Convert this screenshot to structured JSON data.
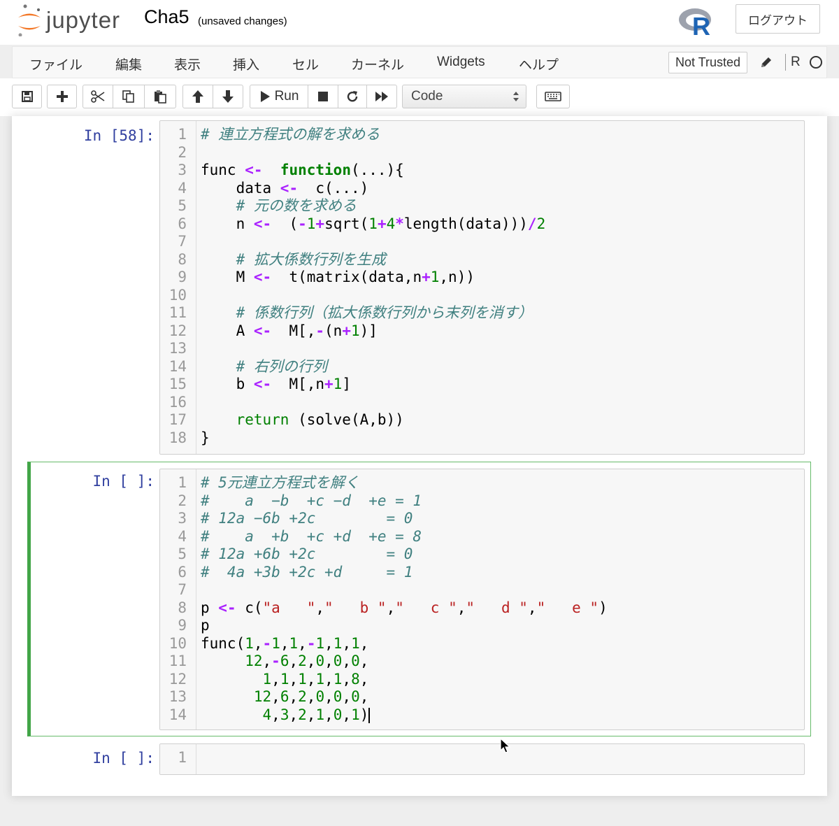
{
  "header": {
    "logo_text": "jupyter",
    "notebook_name": "Cha5",
    "save_status": "(unsaved changes)",
    "kernel_logo": "R",
    "logout_label": "ログアウト"
  },
  "menubar": {
    "items": [
      "ファイル",
      "編集",
      "表示",
      "挿入",
      "セル",
      "カーネル",
      "Widgets",
      "ヘルプ"
    ],
    "trust_label": "Not Trusted",
    "kernel_name": "R"
  },
  "toolbar": {
    "run_label": "Run",
    "cell_type": "Code",
    "icons": [
      "save-icon",
      "plus-icon",
      "cut-icon",
      "copy-icon",
      "paste-icon",
      "arrow-up-icon",
      "arrow-down-icon",
      "play-icon",
      "stop-icon",
      "restart-icon",
      "fast-forward-icon",
      "keyboard-icon"
    ]
  },
  "cells": [
    {
      "prompt": "In [58]:",
      "lines": [
        [
          [
            "c-com",
            "# 連立方程式の解を求める"
          ]
        ],
        [],
        [
          [
            "",
            "func "
          ],
          [
            "c-op",
            "<-"
          ],
          [
            "",
            "  "
          ],
          [
            "c-kw",
            "function"
          ],
          [
            "",
            "(...){"
          ]
        ],
        [
          [
            "",
            "    data "
          ],
          [
            "c-op",
            "<-"
          ],
          [
            "",
            "  c(...)"
          ]
        ],
        [
          [
            "",
            "    "
          ],
          [
            "c-com",
            "# 元の数を求める"
          ]
        ],
        [
          [
            "",
            "    n "
          ],
          [
            "c-op",
            "<-"
          ],
          [
            "",
            "  ("
          ],
          [
            "c-op",
            "-"
          ],
          [
            "c-num",
            "1"
          ],
          [
            "c-op",
            "+"
          ],
          [
            "",
            "sqrt("
          ],
          [
            "c-num",
            "1"
          ],
          [
            "c-op",
            "+"
          ],
          [
            "c-num",
            "4"
          ],
          [
            "c-op",
            "*"
          ],
          [
            "",
            "length(data)))"
          ],
          [
            "c-op",
            "/"
          ],
          [
            "c-num",
            "2"
          ]
        ],
        [],
        [
          [
            "",
            "    "
          ],
          [
            "c-com",
            "# 拡大係数行列を生成"
          ]
        ],
        [
          [
            "",
            "    M "
          ],
          [
            "c-op",
            "<-"
          ],
          [
            "",
            "  t(matrix(data,n"
          ],
          [
            "c-op",
            "+"
          ],
          [
            "c-num",
            "1"
          ],
          [
            "",
            ",n))"
          ]
        ],
        [],
        [
          [
            "",
            "    "
          ],
          [
            "c-com",
            "# 係数行列（拡大係数行列から末列を消す）"
          ]
        ],
        [
          [
            "",
            "    A "
          ],
          [
            "c-op",
            "<-"
          ],
          [
            "",
            "  M[,"
          ],
          [
            "c-op",
            "-"
          ],
          [
            "",
            "(n"
          ],
          [
            "c-op",
            "+"
          ],
          [
            "c-num",
            "1"
          ],
          [
            "",
            ")]"
          ]
        ],
        [],
        [
          [
            "",
            "    "
          ],
          [
            "c-com",
            "# 右列の行列"
          ]
        ],
        [
          [
            "",
            "    b "
          ],
          [
            "c-op",
            "<-"
          ],
          [
            "",
            "  M[,n"
          ],
          [
            "c-op",
            "+"
          ],
          [
            "c-num",
            "1"
          ],
          [
            "",
            "]"
          ]
        ],
        [],
        [
          [
            "",
            "    "
          ],
          [
            "c-ret",
            "return"
          ],
          [
            "",
            " (solve(A,b))"
          ]
        ],
        [
          [
            "",
            "}"
          ]
        ]
      ]
    },
    {
      "prompt": "In [ ]:",
      "lines": [
        [
          [
            "c-com",
            "# 5元連立方程式を解く"
          ]
        ],
        [
          [
            "c-com",
            "#    a  −b  +c −d  +e = 1"
          ]
        ],
        [
          [
            "c-com",
            "# 12a −6b +2c        = 0"
          ]
        ],
        [
          [
            "c-com",
            "#    a  +b  +c +d  +e = 8"
          ]
        ],
        [
          [
            "c-com",
            "# 12a +6b +2c        = 0"
          ]
        ],
        [
          [
            "c-com",
            "#  4a +3b +2c +d     = 1"
          ]
        ],
        [],
        [
          [
            "",
            "p "
          ],
          [
            "c-op",
            "<-"
          ],
          [
            "",
            " c("
          ],
          [
            "c-str",
            "\"a   \""
          ],
          [
            "",
            ","
          ],
          [
            "c-str",
            "\"   b \""
          ],
          [
            "",
            ","
          ],
          [
            "c-str",
            "\"   c \""
          ],
          [
            "",
            ","
          ],
          [
            "c-str",
            "\"   d \""
          ],
          [
            "",
            ","
          ],
          [
            "c-str",
            "\"   e \""
          ],
          [
            "",
            ")"
          ]
        ],
        [
          [
            "",
            "p"
          ]
        ],
        [
          [
            "",
            "func("
          ],
          [
            "c-num",
            "1"
          ],
          [
            "",
            ","
          ],
          [
            "c-op",
            "-"
          ],
          [
            "c-num",
            "1"
          ],
          [
            "",
            ","
          ],
          [
            "c-num",
            "1"
          ],
          [
            "",
            ","
          ],
          [
            "c-op",
            "-"
          ],
          [
            "c-num",
            "1"
          ],
          [
            "",
            ","
          ],
          [
            "c-num",
            "1"
          ],
          [
            "",
            ","
          ],
          [
            "c-num",
            "1"
          ],
          [
            "",
            ","
          ]
        ],
        [
          [
            "",
            "     "
          ],
          [
            "c-num",
            "12"
          ],
          [
            "",
            ","
          ],
          [
            "c-op",
            "-"
          ],
          [
            "c-num",
            "6"
          ],
          [
            "",
            ","
          ],
          [
            "c-num",
            "2"
          ],
          [
            "",
            ","
          ],
          [
            "c-num",
            "0"
          ],
          [
            "",
            ","
          ],
          [
            "c-num",
            "0"
          ],
          [
            "",
            ","
          ],
          [
            "c-num",
            "0"
          ],
          [
            "",
            ","
          ]
        ],
        [
          [
            "",
            "       "
          ],
          [
            "c-num",
            "1"
          ],
          [
            "",
            ","
          ],
          [
            "c-num",
            "1"
          ],
          [
            "",
            ","
          ],
          [
            "c-num",
            "1"
          ],
          [
            "",
            ","
          ],
          [
            "c-num",
            "1"
          ],
          [
            "",
            ","
          ],
          [
            "c-num",
            "1"
          ],
          [
            "",
            ","
          ],
          [
            "c-num",
            "8"
          ],
          [
            "",
            ","
          ]
        ],
        [
          [
            "",
            "      "
          ],
          [
            "c-num",
            "12"
          ],
          [
            "",
            ","
          ],
          [
            "c-num",
            "6"
          ],
          [
            "",
            ","
          ],
          [
            "c-num",
            "2"
          ],
          [
            "",
            ","
          ],
          [
            "c-num",
            "0"
          ],
          [
            "",
            ","
          ],
          [
            "c-num",
            "0"
          ],
          [
            "",
            ","
          ],
          [
            "c-num",
            "0"
          ],
          [
            "",
            ","
          ]
        ],
        [
          [
            "",
            "       "
          ],
          [
            "c-num",
            "4"
          ],
          [
            "",
            ","
          ],
          [
            "c-num",
            "3"
          ],
          [
            "",
            ","
          ],
          [
            "c-num",
            "2"
          ],
          [
            "",
            ","
          ],
          [
            "c-num",
            "1"
          ],
          [
            "",
            ","
          ],
          [
            "c-num",
            "0"
          ],
          [
            "",
            ","
          ],
          [
            "c-num",
            "1"
          ],
          [
            "",
            ")"
          ]
        ]
      ]
    },
    {
      "prompt": "In [ ]:",
      "lines": [
        []
      ]
    }
  ]
}
